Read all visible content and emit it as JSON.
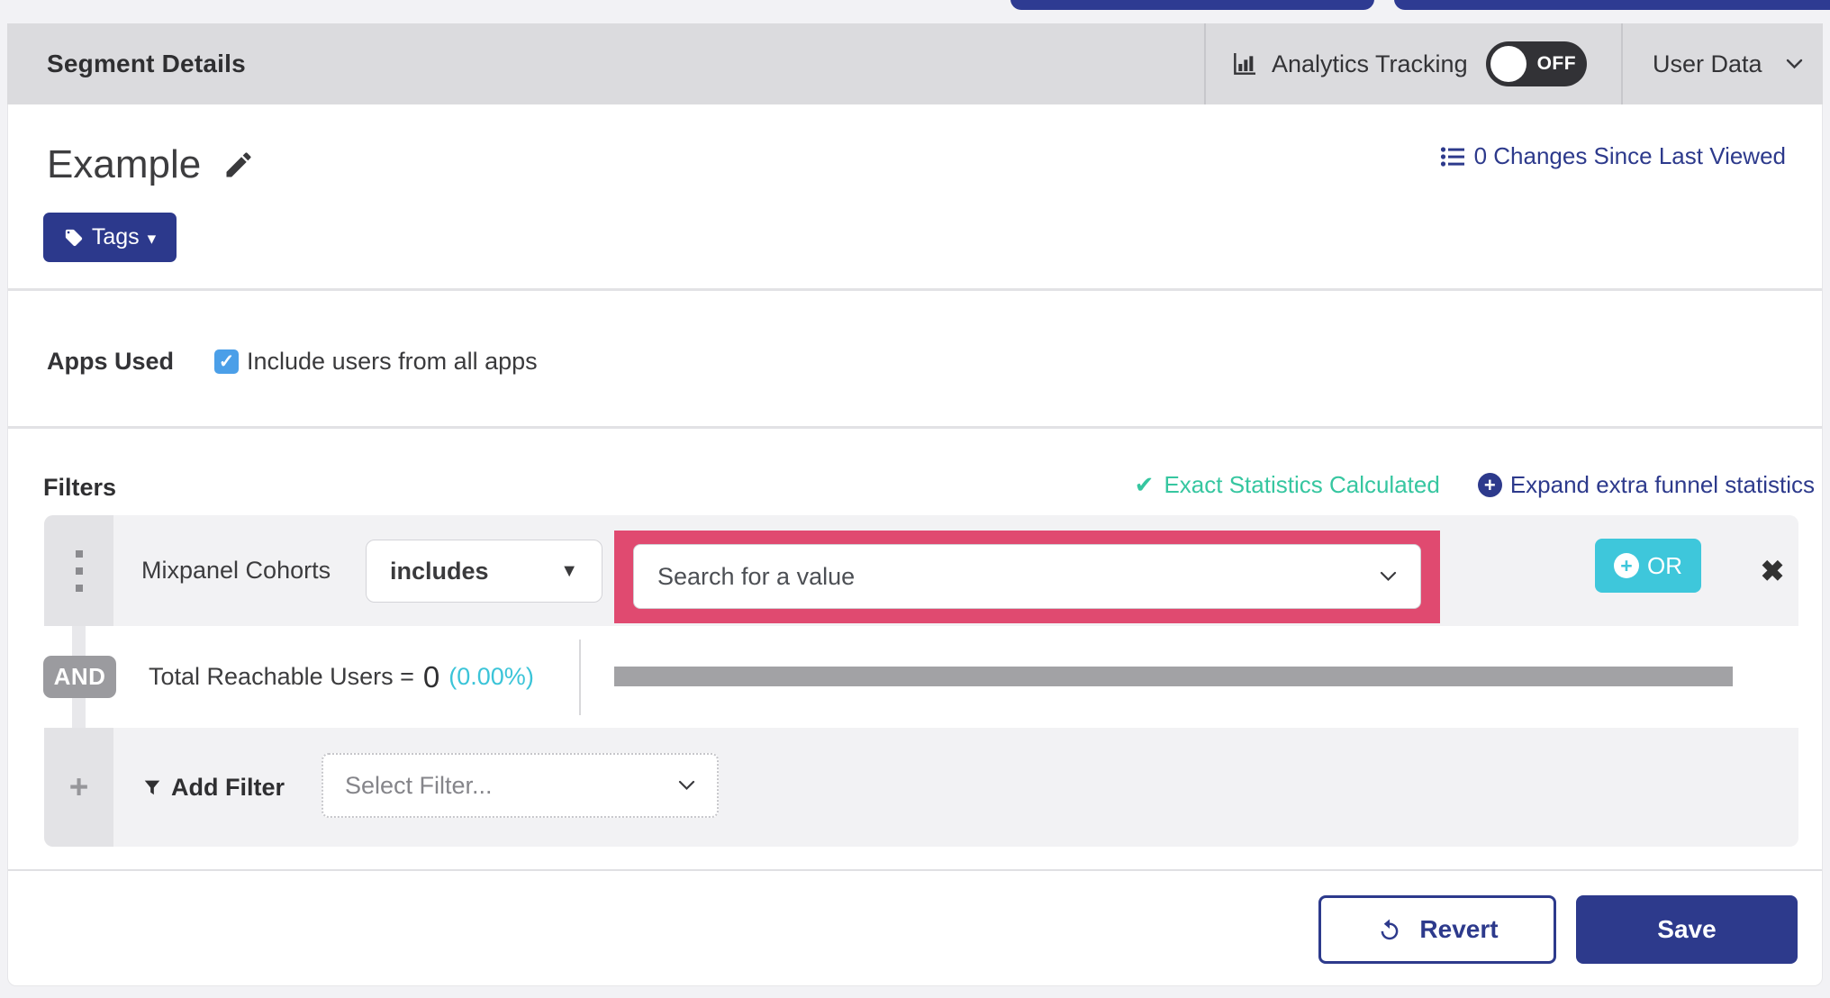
{
  "colors": {
    "indigo": "#2d3a8c",
    "cyan": "#3ec7db",
    "teal": "#36c6a0",
    "annotation_pink": "#e04a70",
    "checkbox_blue": "#4b9fe8",
    "header_gray": "#dbdbde"
  },
  "icons": {
    "check": "✓",
    "heavy_check": "✔",
    "close": "✖",
    "plus": "+",
    "caret_down": "▾",
    "select_caret": "▼"
  },
  "header": {
    "title": "Segment Details",
    "analytics": {
      "label": "Analytics Tracking",
      "toggle_state": "OFF"
    },
    "user_data_label": "User Data"
  },
  "segment": {
    "name": "Example",
    "changes_link": "0 Changes Since Last Viewed",
    "tags_label": "Tags"
  },
  "apps_used": {
    "label": "Apps Used",
    "include_all_label": "Include users from all apps",
    "checked": true
  },
  "filters": {
    "heading": "Filters",
    "exact_stats_label": "Exact Statistics Calculated",
    "expand_stats_label": "Expand extra funnel statistics",
    "row": {
      "field": "Mixpanel Cohorts",
      "operator": "includes",
      "value_placeholder": "Search for a value",
      "or_label": "OR"
    },
    "and_label": "AND",
    "reachable": {
      "label": "Total Reachable Users =",
      "value": "0",
      "percent": "(0.00%)",
      "bar_fill_percent": 0
    },
    "add_filter": {
      "label": "Add Filter",
      "select_placeholder": "Select Filter..."
    }
  },
  "footer": {
    "revert_label": "Revert",
    "save_label": "Save"
  }
}
